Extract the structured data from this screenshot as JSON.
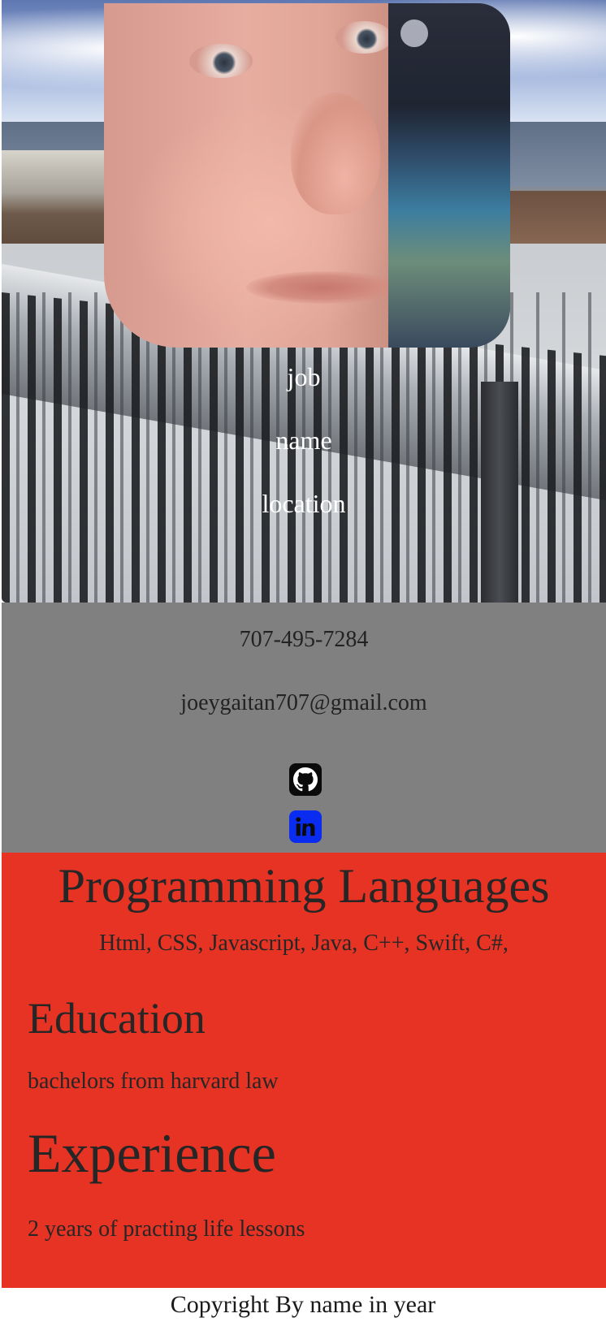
{
  "hero": {
    "job": "job",
    "name": "name",
    "location": "location"
  },
  "contact": {
    "phone": "707-495-7284",
    "email": "joeygaitan707@gmail.com",
    "github_icon": "github-icon",
    "linkedin_icon": "linkedin-icon"
  },
  "skills": {
    "languages_heading": "Programming Languages",
    "languages_list": "Html, CSS, Javascript, Java, C++, Swift, C#,",
    "education_heading": "Education",
    "education_text": "bachelors from harvard law",
    "experience_heading": "Experience",
    "experience_text": "2 years of practing life lessons"
  },
  "footer": {
    "copyright": "Copyright By name in year"
  },
  "colors": {
    "contact_bg": "#808080",
    "skills_bg": "#e63323",
    "linkedin_blue": "#0a2cf0",
    "github_black": "#0a0a0a"
  }
}
